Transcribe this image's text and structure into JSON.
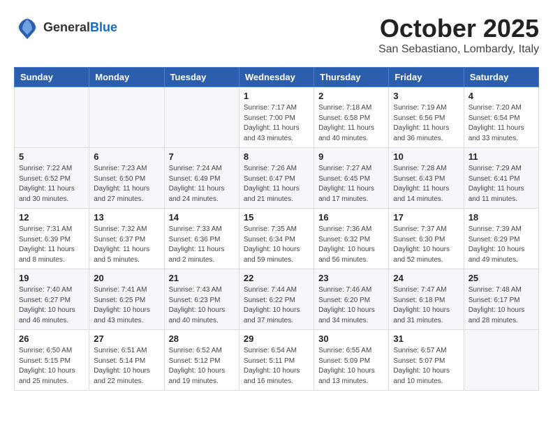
{
  "logo": {
    "text_general": "General",
    "text_blue": "Blue"
  },
  "title": "October 2025",
  "location": "San Sebastiano, Lombardy, Italy",
  "days_of_week": [
    "Sunday",
    "Monday",
    "Tuesday",
    "Wednesday",
    "Thursday",
    "Friday",
    "Saturday"
  ],
  "weeks": [
    [
      {
        "day": "",
        "info": ""
      },
      {
        "day": "",
        "info": ""
      },
      {
        "day": "",
        "info": ""
      },
      {
        "day": "1",
        "info": "Sunrise: 7:17 AM\nSunset: 7:00 PM\nDaylight: 11 hours and 43 minutes."
      },
      {
        "day": "2",
        "info": "Sunrise: 7:18 AM\nSunset: 6:58 PM\nDaylight: 11 hours and 40 minutes."
      },
      {
        "day": "3",
        "info": "Sunrise: 7:19 AM\nSunset: 6:56 PM\nDaylight: 11 hours and 36 minutes."
      },
      {
        "day": "4",
        "info": "Sunrise: 7:20 AM\nSunset: 6:54 PM\nDaylight: 11 hours and 33 minutes."
      }
    ],
    [
      {
        "day": "5",
        "info": "Sunrise: 7:22 AM\nSunset: 6:52 PM\nDaylight: 11 hours and 30 minutes."
      },
      {
        "day": "6",
        "info": "Sunrise: 7:23 AM\nSunset: 6:50 PM\nDaylight: 11 hours and 27 minutes."
      },
      {
        "day": "7",
        "info": "Sunrise: 7:24 AM\nSunset: 6:49 PM\nDaylight: 11 hours and 24 minutes."
      },
      {
        "day": "8",
        "info": "Sunrise: 7:26 AM\nSunset: 6:47 PM\nDaylight: 11 hours and 21 minutes."
      },
      {
        "day": "9",
        "info": "Sunrise: 7:27 AM\nSunset: 6:45 PM\nDaylight: 11 hours and 17 minutes."
      },
      {
        "day": "10",
        "info": "Sunrise: 7:28 AM\nSunset: 6:43 PM\nDaylight: 11 hours and 14 minutes."
      },
      {
        "day": "11",
        "info": "Sunrise: 7:29 AM\nSunset: 6:41 PM\nDaylight: 11 hours and 11 minutes."
      }
    ],
    [
      {
        "day": "12",
        "info": "Sunrise: 7:31 AM\nSunset: 6:39 PM\nDaylight: 11 hours and 8 minutes."
      },
      {
        "day": "13",
        "info": "Sunrise: 7:32 AM\nSunset: 6:37 PM\nDaylight: 11 hours and 5 minutes."
      },
      {
        "day": "14",
        "info": "Sunrise: 7:33 AM\nSunset: 6:36 PM\nDaylight: 11 hours and 2 minutes."
      },
      {
        "day": "15",
        "info": "Sunrise: 7:35 AM\nSunset: 6:34 PM\nDaylight: 10 hours and 59 minutes."
      },
      {
        "day": "16",
        "info": "Sunrise: 7:36 AM\nSunset: 6:32 PM\nDaylight: 10 hours and 56 minutes."
      },
      {
        "day": "17",
        "info": "Sunrise: 7:37 AM\nSunset: 6:30 PM\nDaylight: 10 hours and 52 minutes."
      },
      {
        "day": "18",
        "info": "Sunrise: 7:39 AM\nSunset: 6:29 PM\nDaylight: 10 hours and 49 minutes."
      }
    ],
    [
      {
        "day": "19",
        "info": "Sunrise: 7:40 AM\nSunset: 6:27 PM\nDaylight: 10 hours and 46 minutes."
      },
      {
        "day": "20",
        "info": "Sunrise: 7:41 AM\nSunset: 6:25 PM\nDaylight: 10 hours and 43 minutes."
      },
      {
        "day": "21",
        "info": "Sunrise: 7:43 AM\nSunset: 6:23 PM\nDaylight: 10 hours and 40 minutes."
      },
      {
        "day": "22",
        "info": "Sunrise: 7:44 AM\nSunset: 6:22 PM\nDaylight: 10 hours and 37 minutes."
      },
      {
        "day": "23",
        "info": "Sunrise: 7:46 AM\nSunset: 6:20 PM\nDaylight: 10 hours and 34 minutes."
      },
      {
        "day": "24",
        "info": "Sunrise: 7:47 AM\nSunset: 6:18 PM\nDaylight: 10 hours and 31 minutes."
      },
      {
        "day": "25",
        "info": "Sunrise: 7:48 AM\nSunset: 6:17 PM\nDaylight: 10 hours and 28 minutes."
      }
    ],
    [
      {
        "day": "26",
        "info": "Sunrise: 6:50 AM\nSunset: 5:15 PM\nDaylight: 10 hours and 25 minutes."
      },
      {
        "day": "27",
        "info": "Sunrise: 6:51 AM\nSunset: 5:14 PM\nDaylight: 10 hours and 22 minutes."
      },
      {
        "day": "28",
        "info": "Sunrise: 6:52 AM\nSunset: 5:12 PM\nDaylight: 10 hours and 19 minutes."
      },
      {
        "day": "29",
        "info": "Sunrise: 6:54 AM\nSunset: 5:11 PM\nDaylight: 10 hours and 16 minutes."
      },
      {
        "day": "30",
        "info": "Sunrise: 6:55 AM\nSunset: 5:09 PM\nDaylight: 10 hours and 13 minutes."
      },
      {
        "day": "31",
        "info": "Sunrise: 6:57 AM\nSunset: 5:07 PM\nDaylight: 10 hours and 10 minutes."
      },
      {
        "day": "",
        "info": ""
      }
    ]
  ]
}
